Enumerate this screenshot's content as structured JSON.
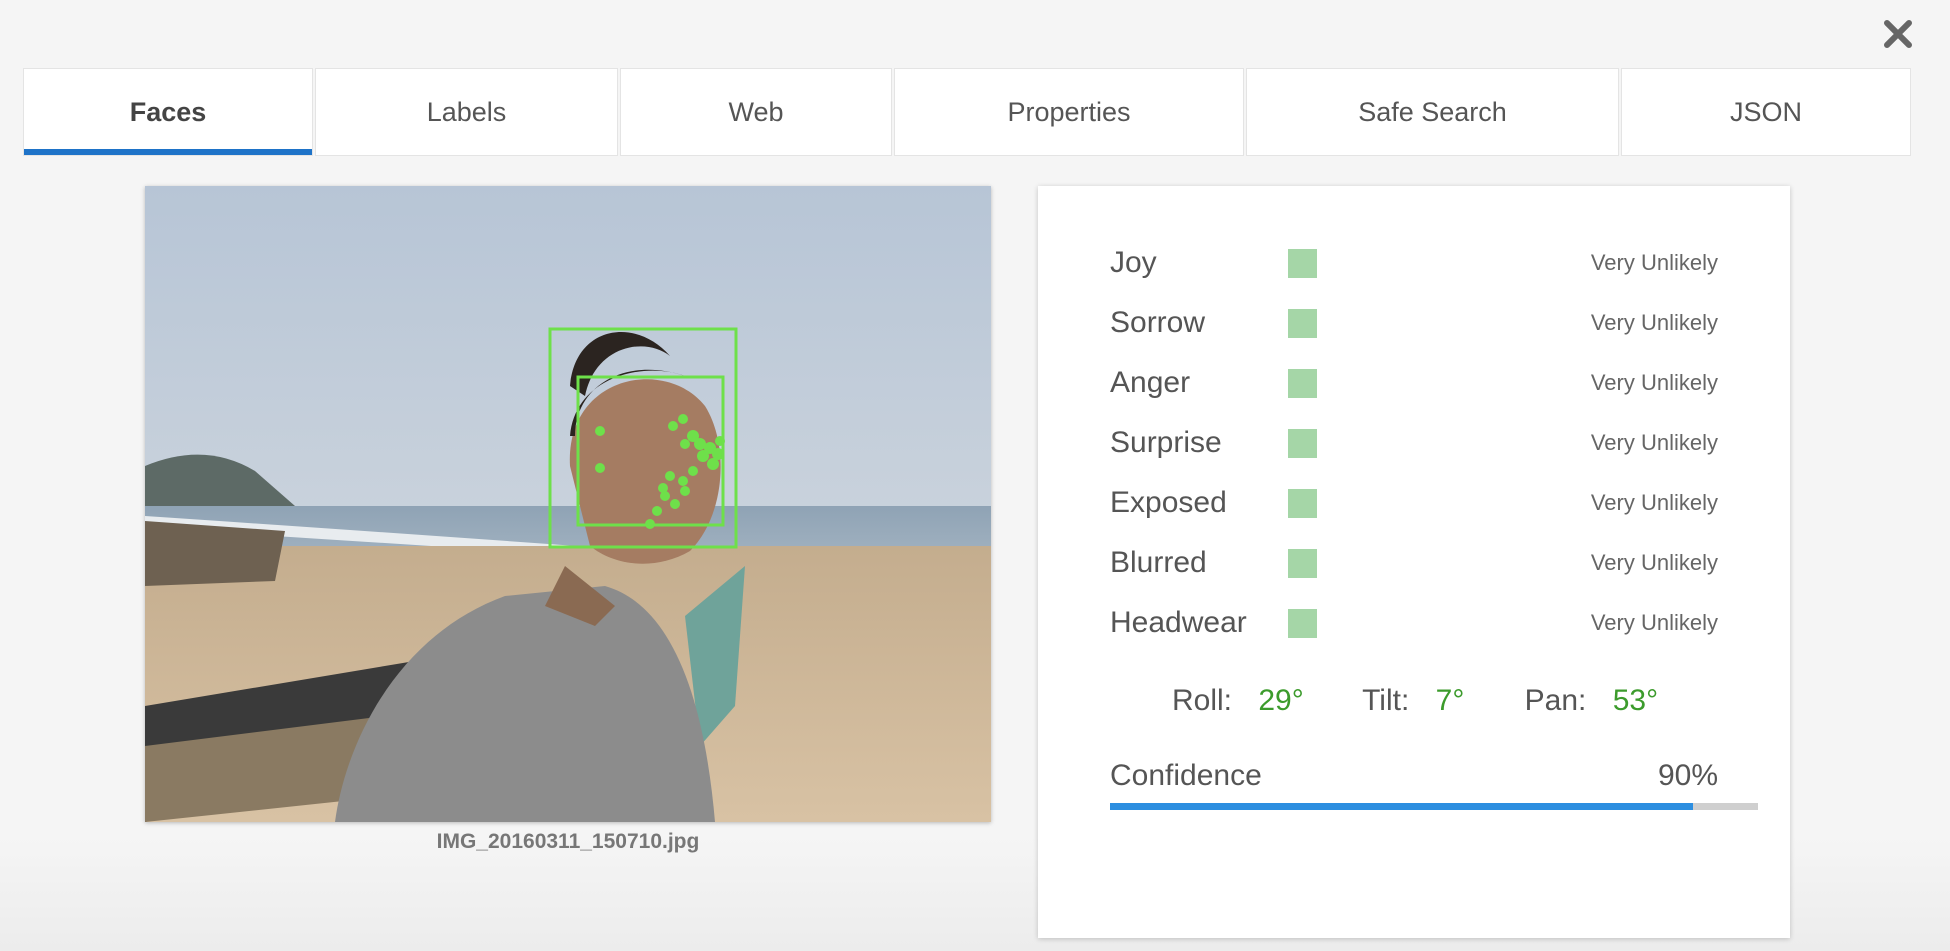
{
  "dialog": {
    "close_icon": "close-icon"
  },
  "tabs": [
    {
      "label": "Faces",
      "active": true
    },
    {
      "label": "Labels",
      "active": false
    },
    {
      "label": "Web",
      "active": false
    },
    {
      "label": "Properties",
      "active": false
    },
    {
      "label": "Safe Search",
      "active": false
    },
    {
      "label": "JSON",
      "active": false
    }
  ],
  "image": {
    "filename": "IMG_20160311_150710.jpg"
  },
  "face": {
    "attributes": [
      {
        "label": "Joy",
        "value": "Very Unlikely"
      },
      {
        "label": "Sorrow",
        "value": "Very Unlikely"
      },
      {
        "label": "Anger",
        "value": "Very Unlikely"
      },
      {
        "label": "Surprise",
        "value": "Very Unlikely"
      },
      {
        "label": "Exposed",
        "value": "Very Unlikely"
      },
      {
        "label": "Blurred",
        "value": "Very Unlikely"
      },
      {
        "label": "Headwear",
        "value": "Very Unlikely"
      }
    ],
    "angles": {
      "roll_label": "Roll:",
      "roll_value": "29°",
      "tilt_label": "Tilt:",
      "tilt_value": "7°",
      "pan_label": "Pan:",
      "pan_value": "53°"
    },
    "confidence": {
      "label": "Confidence",
      "value_text": "90%",
      "value": 0.9
    }
  },
  "colors": {
    "tab_indicator": "#1e73c8",
    "likelihood_square": "#a5d6a7",
    "angle_value": "#3c9b2c",
    "confidence_bar": "#2c8ee0",
    "face_box": "#6ee04a"
  }
}
